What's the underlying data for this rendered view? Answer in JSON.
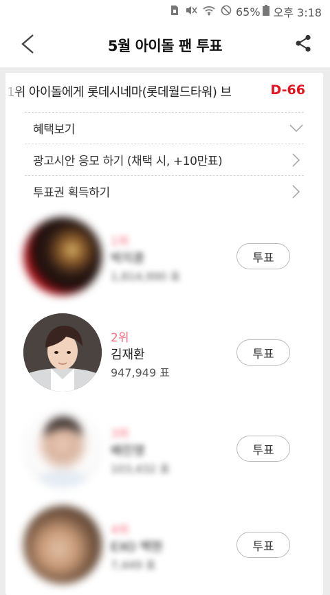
{
  "status_bar": {
    "battery": "65%",
    "time": "오후 3:18",
    "icons": [
      "sim-icon",
      "mute-icon",
      "wifi-icon",
      "do-not-disturb-icon",
      "battery-icon"
    ]
  },
  "header": {
    "title": "5월 아이돌 팬 투표",
    "back_icon": "chevron-left-icon",
    "share_icon": "share-icon"
  },
  "banner": {
    "text": "1위 아이돌에게 롯데시네마(롯데월드타워) 브",
    "dday": "D-66"
  },
  "menu": [
    {
      "label": "혜택보기",
      "icon": "chevron-down-icon"
    },
    {
      "label": "광고시안 응모 하기 (채택 시, +10만표)",
      "icon": "chevron-right-icon"
    },
    {
      "label": "투표권 획득하기",
      "icon": "chevron-right-icon"
    }
  ],
  "candidates": [
    {
      "rank": "1위",
      "name": "박지훈",
      "votes": "1,814,990 표",
      "vote_label": "투표",
      "blurred": true
    },
    {
      "rank": "2위",
      "name": "김재환",
      "votes": "947,949 표",
      "vote_label": "투표",
      "blurred": false
    },
    {
      "rank": "3위",
      "name": "배진영",
      "votes": "103,432 표",
      "vote_label": "투표",
      "blurred": true
    },
    {
      "rank": "4위",
      "name": "EXO 백현",
      "votes": "7,449 표",
      "vote_label": "투표",
      "blurred": true
    }
  ],
  "colors": {
    "accent_red": "#e8121e",
    "rank_pink": "#f36e7f",
    "background": "#ececec"
  }
}
